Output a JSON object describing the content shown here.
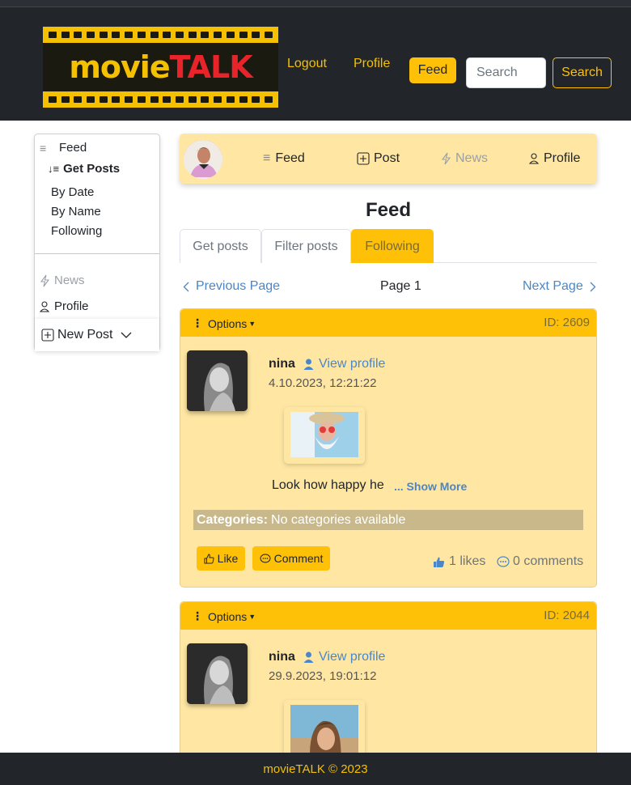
{
  "brand": {
    "word1": "movie",
    "word2": "TALK"
  },
  "nav": {
    "logout": "Logout",
    "profile": "Profile",
    "feed": "Feed",
    "search_placeholder": "Search",
    "search_button": "Search"
  },
  "sidebar": {
    "feed": "Feed",
    "get_posts": "Get Posts",
    "sort_items": [
      "By Date",
      "By Name",
      "Following"
    ],
    "news": "News",
    "profile": "Profile",
    "new_post": "New Post"
  },
  "profile_bar": {
    "feed": "Feed",
    "post": "Post",
    "news": "News",
    "profile": "Profile"
  },
  "page_title": "Feed",
  "tabs": [
    {
      "label": "Get posts"
    },
    {
      "label": "Filter posts"
    },
    {
      "label": "Following"
    }
  ],
  "pager": {
    "prev": "Previous Page",
    "current": "Page 1",
    "next": "Next Page"
  },
  "posts": [
    {
      "options": "Options",
      "id": "ID: 2609",
      "user": "nina",
      "view_profile": "View profile",
      "date": "4.10.2023, 12:21:22",
      "text": "Look how happy he",
      "show_more": "... Show More",
      "categories_label": "Categories:",
      "categories_value": "No categories available",
      "like_label": "Like",
      "comment_label": "Comment",
      "likes": "1 likes",
      "comments": "0 comments"
    },
    {
      "options": "Options",
      "id": "ID: 2044",
      "user": "nina",
      "view_profile": "View profile",
      "date": "29.9.2023, 19:01:12"
    }
  ],
  "footer": "movieTALK © 2023",
  "colors": {
    "accent": "#ffc107",
    "card_bg": "#ffe7a3",
    "header_bg": "#22252a",
    "link": "#4a86c8"
  }
}
